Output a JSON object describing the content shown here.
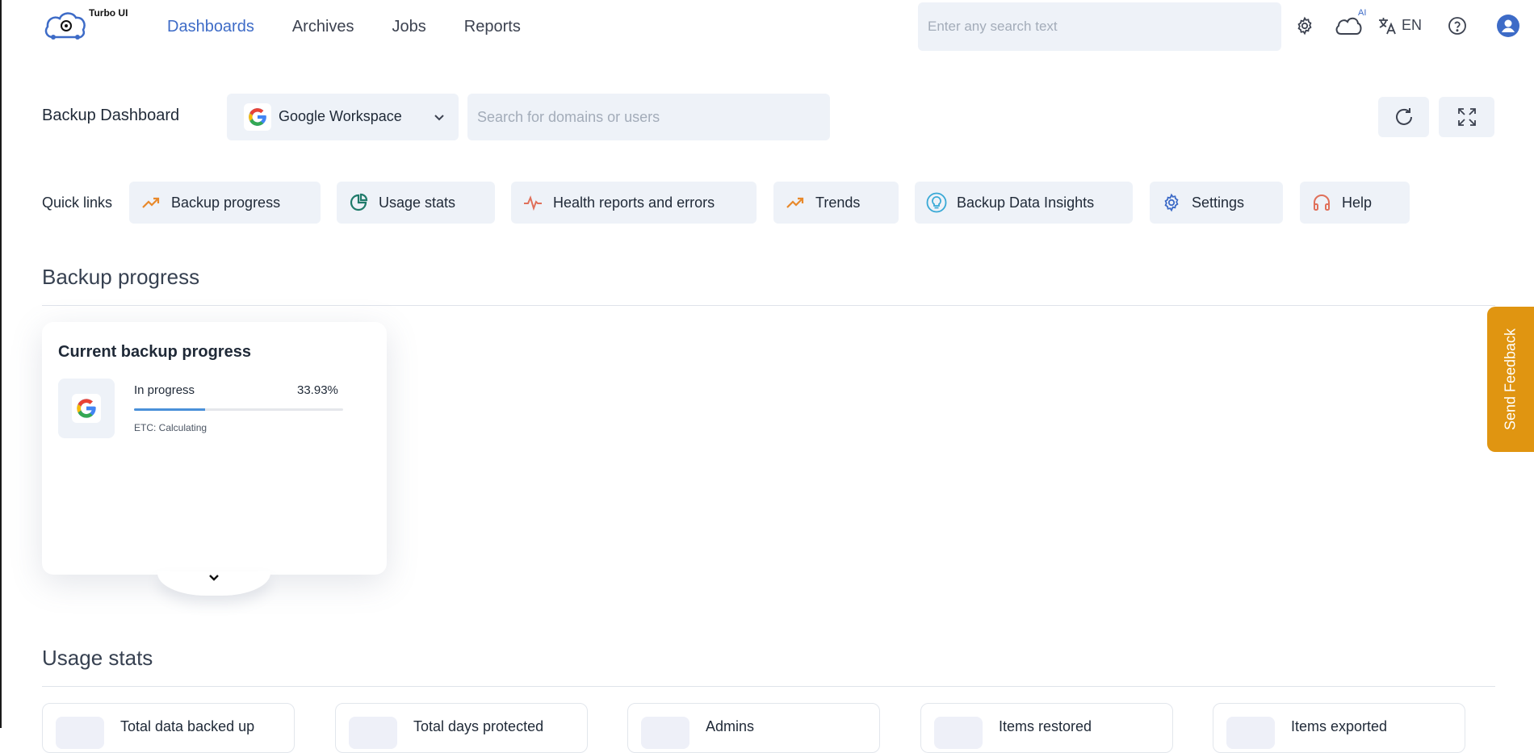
{
  "app": {
    "logo_text": "Turbo UI"
  },
  "nav": {
    "items": [
      {
        "label": "Dashboards",
        "active": true
      },
      {
        "label": "Archives",
        "active": false
      },
      {
        "label": "Jobs",
        "active": false
      },
      {
        "label": "Reports",
        "active": false
      }
    ]
  },
  "top_search": {
    "placeholder": "Enter any search text"
  },
  "toolbar": {
    "ai_badge": "AI",
    "language": "EN"
  },
  "header": {
    "title": "Backup Dashboard",
    "workspace": "Google Workspace",
    "domain_search_placeholder": "Search for domains or users"
  },
  "quick_links": {
    "label": "Quick links",
    "items": [
      {
        "label": "Backup progress",
        "icon": "trend-up-icon",
        "color": "#e8892b"
      },
      {
        "label": "Usage stats",
        "icon": "pie-chart-icon",
        "color": "#1f7a6a"
      },
      {
        "label": "Health reports and errors",
        "icon": "pulse-icon",
        "color": "#e0705a"
      },
      {
        "label": "Trends",
        "icon": "trend-up-icon",
        "color": "#e8892b"
      },
      {
        "label": "Backup Data Insights",
        "icon": "lightbulb-icon",
        "color": "#39a9d6"
      },
      {
        "label": "Settings",
        "icon": "gear-icon",
        "color": "#3d6bc7"
      },
      {
        "label": "Help",
        "icon": "headset-icon",
        "color": "#e0705a"
      }
    ]
  },
  "backup_progress": {
    "section_title": "Backup progress",
    "card": {
      "title": "Current backup progress",
      "status": "In progress",
      "percent_text": "33.93%",
      "percent": 33.93,
      "etc": "ETC: Calculating"
    }
  },
  "usage_stats": {
    "section_title": "Usage stats",
    "cards": [
      {
        "label": "Total data backed up"
      },
      {
        "label": "Total days protected"
      },
      {
        "label": "Admins"
      },
      {
        "label": "Items restored"
      },
      {
        "label": "Items exported"
      }
    ]
  },
  "feedback": {
    "label": "Send Feedback"
  },
  "colors": {
    "accent": "#3d6bc7",
    "feedback": "#e09511",
    "progress": "#4a90d9"
  }
}
